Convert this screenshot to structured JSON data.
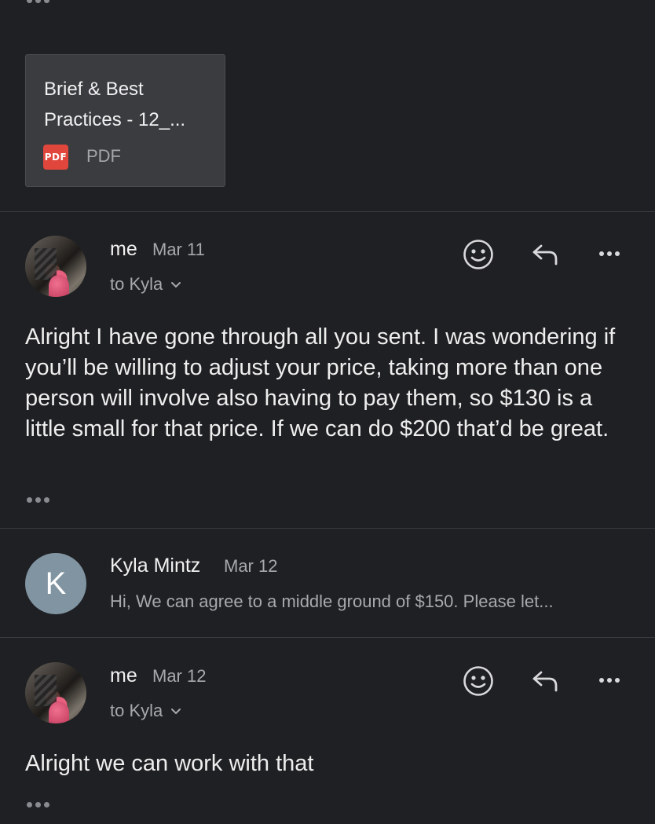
{
  "attachment": {
    "name": "Brief & Best Practices - 12_...",
    "badge": "PDF",
    "type": "PDF"
  },
  "messages": [
    {
      "sender": "me",
      "date": "Mar 11",
      "recipient": "to Kyla",
      "body": "Alright I have gone through all you sent. I was wondering if you’ll be willing to adjust your price, taking more than one person will involve also having to pay them, so $130 is a little small for that price. If we can do $200 that’d be great."
    },
    {
      "sender": "Kyla Mintz",
      "date": "Mar 12",
      "avatar_letter": "K",
      "snippet": "Hi, We can agree to a middle ground of $150. Please let..."
    },
    {
      "sender": "me",
      "date": "Mar 12",
      "recipient": "to Kyla",
      "body": "Alright we can work with that"
    }
  ],
  "icons": {
    "emoji": "smiley-face-icon",
    "reply": "reply-icon",
    "more": "more-options-icon",
    "expand": "chevron-down-icon"
  },
  "colors": {
    "background": "#1f2023",
    "attachment_bg": "#3a3c40",
    "pdf_red": "#e0463b",
    "avatar_k": "#8094a2"
  }
}
